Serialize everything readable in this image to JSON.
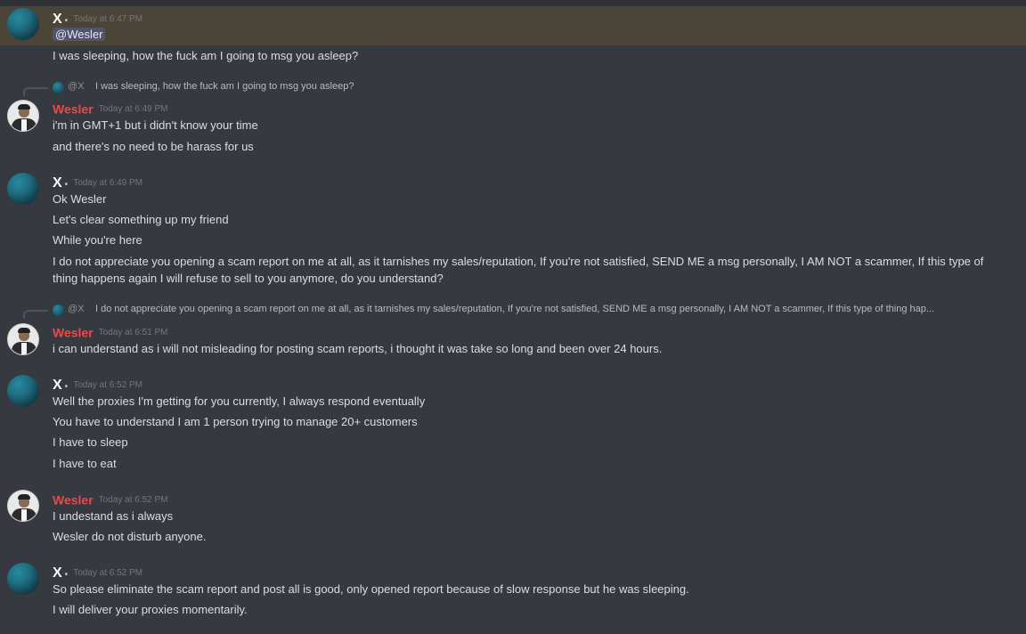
{
  "messages": [
    {
      "author": "X",
      "author_badge": "•",
      "timestamp": "Today at 6:47 PM",
      "mention": "@Wesler",
      "lines": [
        "I was sleeping, how the fuck am I going to msg you asleep?"
      ]
    },
    {
      "reply_to": {
        "name": "@X",
        "text": "I was sleeping, how the fuck am I going to msg you asleep?"
      },
      "author": "Wesler",
      "timestamp": "Today at 6:49 PM",
      "lines": [
        "i'm in GMT+1 but i didn't know your time",
        "and there's no need to be harass for us"
      ]
    },
    {
      "author": "X",
      "author_badge": "•",
      "timestamp": "Today at 6:49 PM",
      "lines": [
        "Ok Wesler",
        "Let's clear something up my friend",
        "While you're here",
        "I do not appreciate you opening a scam report on me at all, as it tarnishes my sales/reputation, If you're not satisfied, SEND ME a msg personally, I AM NOT a scammer, If this type of thing happens again I will refuse to sell to you anymore, do you understand?"
      ]
    },
    {
      "reply_to": {
        "name": "@X",
        "text": "I do not appreciate you opening a scam report on me at all, as it tarnishes my sales/reputation, If you're not satisfied, SEND ME a msg personally, I AM NOT a scammer, If this type of thing hap..."
      },
      "author": "Wesler",
      "timestamp": "Today at 6:51 PM",
      "lines": [
        "i can understand as i will not misleading for posting scam reports, i thought it was take so long and been over 24 hours."
      ]
    },
    {
      "author": "X",
      "author_badge": "•",
      "timestamp": "Today at 6:52 PM",
      "lines": [
        "Well the proxies I'm getting for you currently, I always respond eventually",
        "You have to understand I am 1 person trying to manage 20+ customers",
        "I have to sleep",
        "I have to eat"
      ]
    },
    {
      "author": "Wesler",
      "timestamp": "Today at 6:52 PM",
      "lines": [
        "I undestand as i always",
        "Wesler do not disturb anyone."
      ]
    },
    {
      "author": "X",
      "author_badge": "•",
      "timestamp": "Today at 6:52 PM",
      "lines": [
        "So please eliminate the scam report and post all is good, only opened report because of slow response but he was sleeping.",
        "I will deliver your proxies momentarily."
      ]
    }
  ],
  "colors": {
    "background": "#36393f",
    "mention_highlight": "#4a4536",
    "wesler_name": "#f04747",
    "text": "#dcddde",
    "timestamp": "#72767d"
  },
  "icons": {
    "x_avatar": "teal-gradient-avatar",
    "wesler_avatar": "user-photo-avatar",
    "reply": "reply-spine-icon"
  }
}
